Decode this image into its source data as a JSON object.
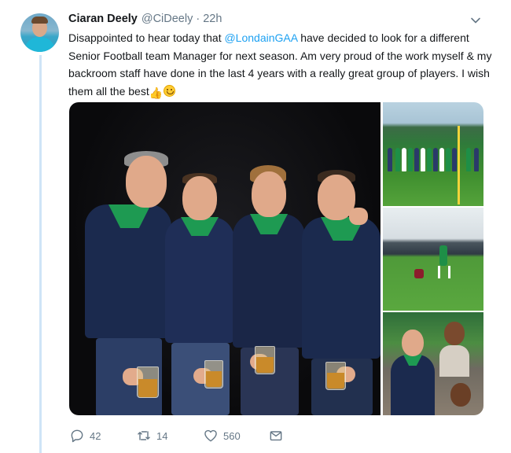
{
  "tweet": {
    "author_name": "Ciaran Deely",
    "author_handle": "@CiDeely",
    "separator": "·",
    "time": "22h",
    "text_before_mention": "Disappointed to hear today that ",
    "mention": "@LondainGAA",
    "text_after_mention": " have decided to look for a different Senior Football team Manager for next season. Am very proud of the work myself & my backroom staff have done in the last 4 years with a really great group of players. I wish them all the best",
    "emojis": [
      "thumbs-up-emoji",
      "smiling-face-emoji"
    ]
  },
  "actions": {
    "reply_count": "42",
    "retweet_count": "14",
    "like_count": "560"
  },
  "icons": [
    "reply-icon",
    "retweet-icon",
    "like-icon",
    "message-icon",
    "chevron-down-icon"
  ],
  "colors": {
    "link": "#1da1f2",
    "muted": "#657786",
    "thread_line": "#cfe4f7"
  }
}
